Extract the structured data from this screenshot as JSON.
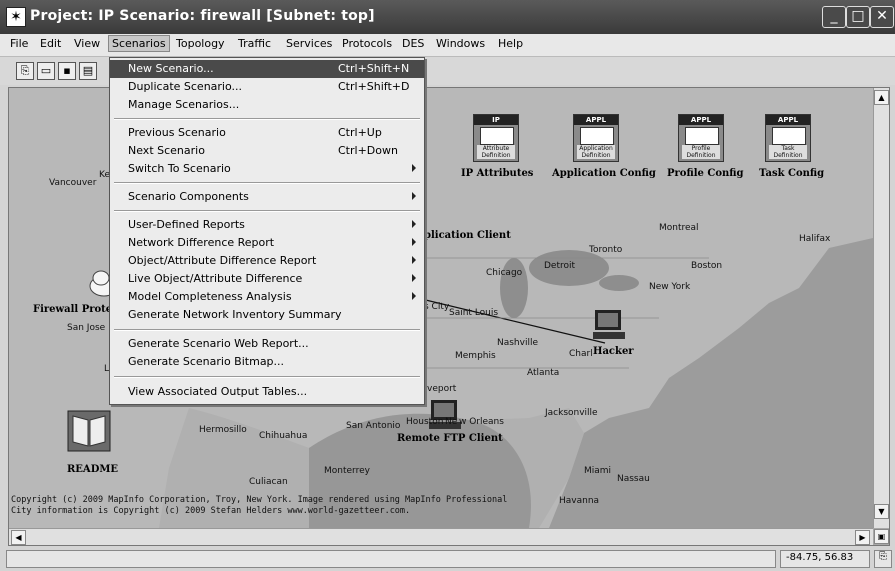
{
  "window": {
    "title": "Project: IP Scenario: firewall  [Subnet: top]",
    "buttons": [
      "minimize-icon",
      "maximize-icon",
      "close-icon"
    ]
  },
  "menubar": [
    "File",
    "Edit",
    "View",
    "Scenarios",
    "Topology",
    "Traffic",
    "Services",
    "Protocols",
    "DES",
    "Windows",
    "Help"
  ],
  "dropdown": {
    "items": [
      {
        "label": "New Scenario...",
        "shortcut": "Ctrl+Shift+N",
        "submenu": false,
        "highlighted": true
      },
      {
        "label": "Duplicate Scenario...",
        "shortcut": "Ctrl+Shift+D",
        "submenu": false
      },
      {
        "label": "Manage Scenarios...",
        "shortcut": "",
        "submenu": false
      },
      {
        "label": "Previous Scenario",
        "shortcut": "Ctrl+Up",
        "submenu": false
      },
      {
        "label": "Next Scenario",
        "shortcut": "Ctrl+Down",
        "submenu": false
      },
      {
        "label": "Switch To Scenario",
        "shortcut": "",
        "submenu": true
      },
      {
        "label": "Scenario Components",
        "shortcut": "",
        "submenu": true
      },
      {
        "label": "User-Defined Reports",
        "shortcut": "",
        "submenu": true
      },
      {
        "label": "Network Difference Report",
        "shortcut": "",
        "submenu": true
      },
      {
        "label": "Object/Attribute Difference Report",
        "shortcut": "",
        "submenu": true
      },
      {
        "label": "Live Object/Attribute Difference",
        "shortcut": "",
        "submenu": true
      },
      {
        "label": "Model Completeness Analysis",
        "shortcut": "",
        "submenu": true
      },
      {
        "label": "Generate Network Inventory Summary",
        "shortcut": "",
        "submenu": false
      },
      {
        "label": "Generate Scenario Web Report...",
        "shortcut": "",
        "submenu": false
      },
      {
        "label": "Generate Scenario Bitmap...",
        "shortcut": "",
        "submenu": false
      },
      {
        "label": "View Associated Output Tables...",
        "shortcut": "",
        "submenu": false
      }
    ]
  },
  "nodes": {
    "ip_attributes": {
      "header": "IP",
      "sub": "Attribute Definition",
      "label": "IP Attributes"
    },
    "app_config": {
      "header": "APPL",
      "sub": "Application Definition",
      "label": "Application Config"
    },
    "profile_config": {
      "header": "APPL",
      "sub": "Profile Definition",
      "label": "Profile Config"
    },
    "task_config": {
      "header": "APPL",
      "sub": "Task Definition",
      "label": "Task Config"
    },
    "app_client": "plication Client",
    "hacker": "Hacker",
    "remote_ftp": "Remote FTP Client",
    "firewall": "Firewall Prote",
    "readme": "README"
  },
  "places": [
    "Vancouver",
    "Ke",
    "San Jose",
    "L",
    "Montreal",
    "Halifax",
    "Toronto",
    "Detroit",
    "Boston",
    "Chicago",
    "New York",
    "s City",
    "Saint Louis",
    "Nashville",
    "Charl",
    "Memphis",
    "Atlanta",
    "veport",
    "Houston",
    "Ne",
    "w Orleans",
    "San Antonio",
    "Jacksonville",
    "Hermosillo",
    "Chihuahua",
    "Monterrey",
    "Culiacan",
    "Miami",
    "Nassau",
    "Havanna"
  ],
  "copyright": {
    "line1": "Copyright (c) 2009 MapInfo Corporation, Troy, New York. Image rendered using MapInfo Professional",
    "line2": "City information is Copyright (c) 2009 Stefan Helders www.world-gazetteer.com."
  },
  "status": {
    "coords": "-84.75, 56.83"
  }
}
